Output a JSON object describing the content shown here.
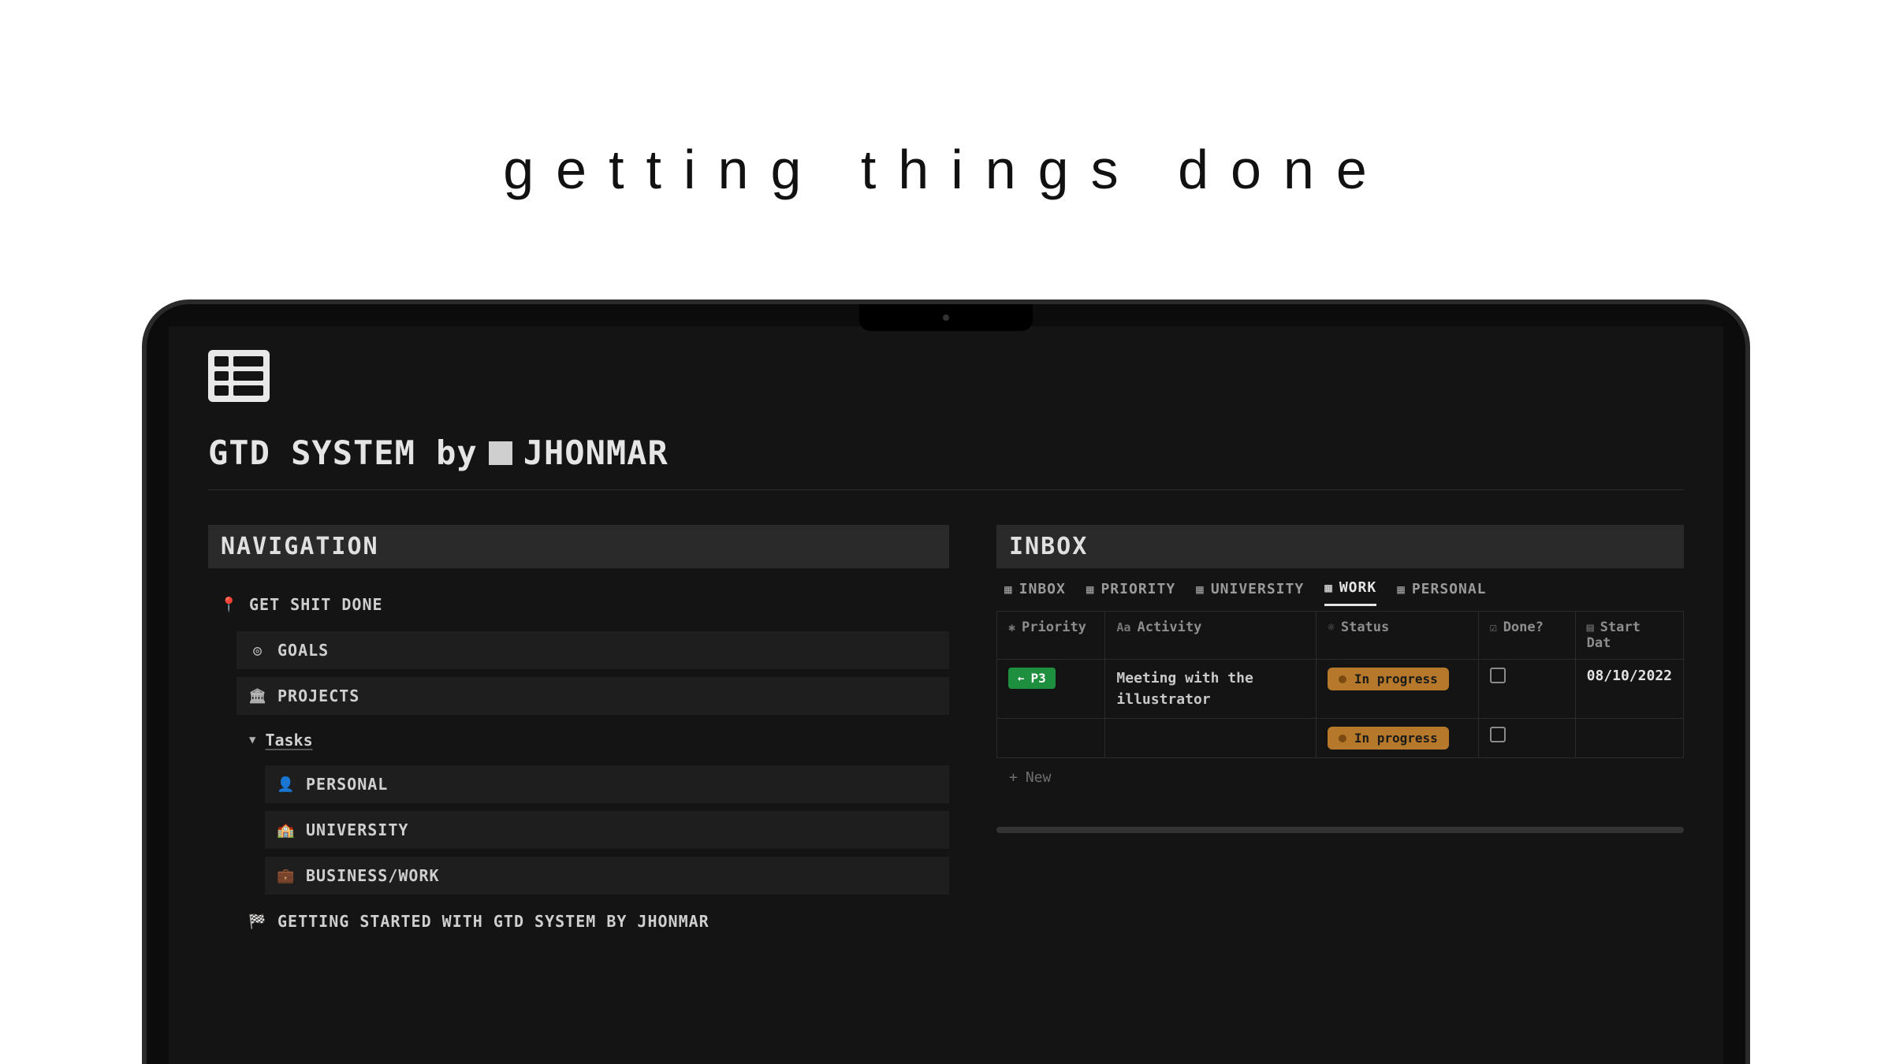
{
  "hero": {
    "title": "getting things done"
  },
  "page": {
    "title_prefix": "GTD SYSTEM by",
    "title_author": "JHONMAR"
  },
  "navigation": {
    "heading": "NAVIGATION",
    "items": [
      {
        "icon": "📍",
        "label": "GET SHIT DONE",
        "indent": 0,
        "boxed": false
      },
      {
        "icon": "◎",
        "label": "GOALS",
        "indent": 1,
        "boxed": true
      },
      {
        "icon": "🏛",
        "label": "PROJECTS",
        "indent": 1,
        "boxed": true
      }
    ],
    "group": {
      "label": "Tasks"
    },
    "group_items": [
      {
        "icon": "👤",
        "label": "PERSONAL"
      },
      {
        "icon": "🏫",
        "label": "UNIVERSITY"
      },
      {
        "icon": "💼",
        "label": "BUSINESS/WORK"
      }
    ],
    "footer": {
      "icon": "🏁",
      "label": "GETTING STARTED WITH GTD SYSTEM BY JHONMAR"
    }
  },
  "inbox": {
    "heading": "INBOX",
    "tabs": [
      {
        "label": "INBOX",
        "active": false
      },
      {
        "label": "PRIORITY",
        "active": false
      },
      {
        "label": "UNIVERSITY",
        "active": false
      },
      {
        "label": "WORK",
        "active": true
      },
      {
        "label": "PERSONAL",
        "active": false
      }
    ],
    "columns": {
      "priority": "Priority",
      "activity": "Activity",
      "status": "Status",
      "done": "Done?",
      "start_date": "Start Dat"
    },
    "rows": [
      {
        "priority": "P3",
        "activity": "Meeting with the illustrator",
        "status": "In progress",
        "done": false,
        "start_date": "08/10/2022"
      },
      {
        "priority": "",
        "activity": "",
        "status": "In progress",
        "done": false,
        "start_date": ""
      }
    ],
    "new_label": "New"
  }
}
